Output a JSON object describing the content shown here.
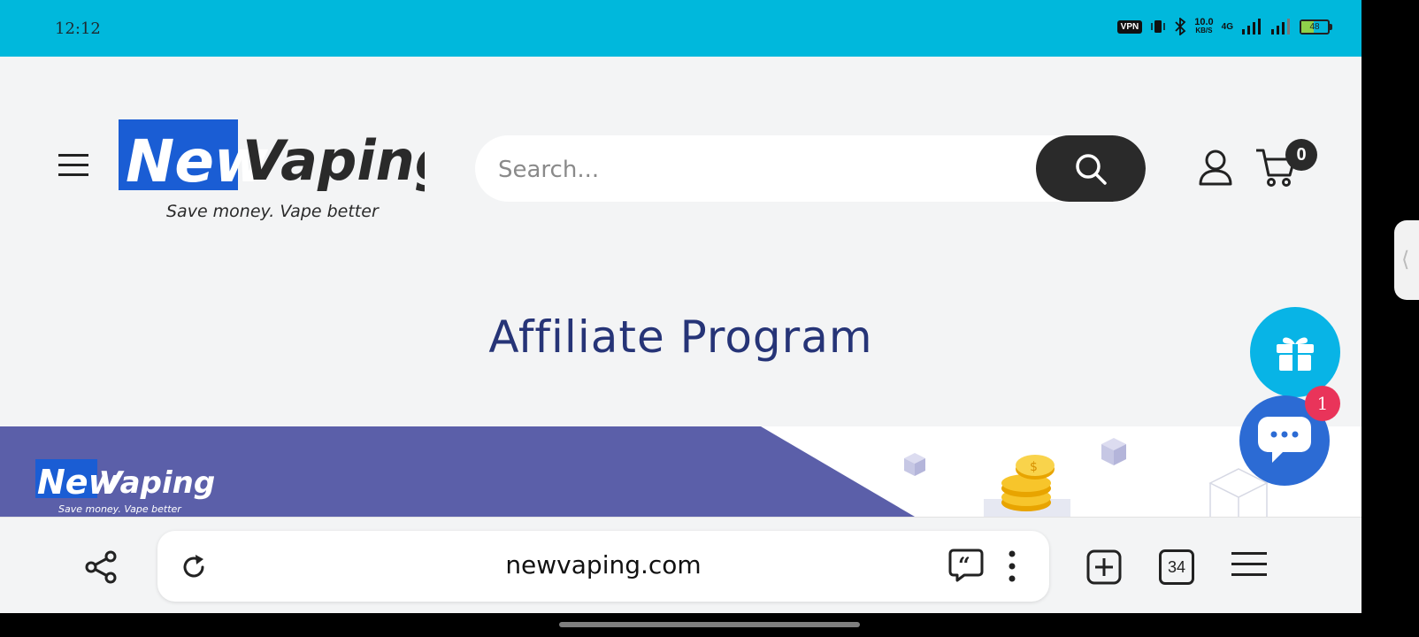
{
  "status_bar": {
    "time": "12:12",
    "vpn_label": "VPN",
    "net_speed": "10.0",
    "net_unit": "KB/S",
    "network_type": "4G",
    "battery": "48"
  },
  "header": {
    "logo_text_new": "New",
    "logo_text_vaping": "Vaping",
    "logo_tagline": "Save money. Vape better",
    "search_placeholder": "Search...",
    "cart_count": "0"
  },
  "main": {
    "title": "Affiliate Program"
  },
  "banner": {
    "logo_text_new": "New",
    "logo_text_vaping": "Vaping",
    "logo_tagline": "Save money. Vape better"
  },
  "floating": {
    "chat_badge": "1"
  },
  "browser": {
    "url": "newvaping.com",
    "tab_count": "34"
  },
  "colors": {
    "status_bar": "#00b8dc",
    "brand_blue": "#1a5dd4",
    "title": "#263477",
    "banner_purple": "#5b5fa9",
    "gift_button": "#08b4e6",
    "chat_button": "#2c6bd4",
    "badge_red": "#e9345a"
  },
  "icons": [
    "hamburger-icon",
    "search-icon",
    "user-icon",
    "cart-icon",
    "gift-icon",
    "chat-icon",
    "share-icon",
    "reload-icon",
    "quote-icon",
    "kebab-icon",
    "new-tab-icon",
    "menu-icon"
  ]
}
